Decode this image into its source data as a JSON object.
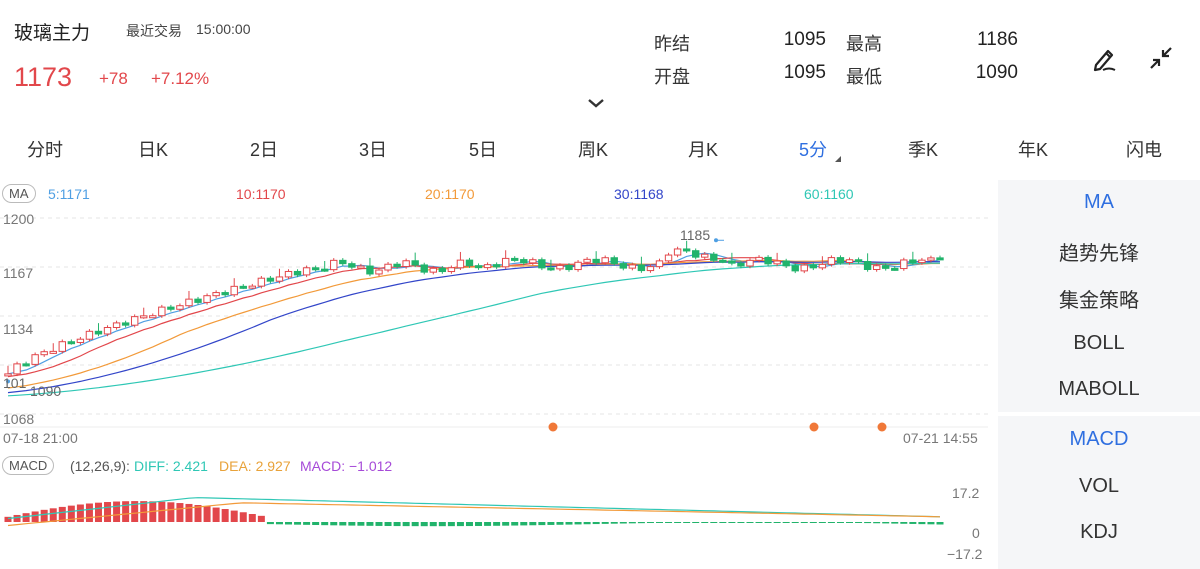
{
  "header": {
    "title": "玻璃主力",
    "trade_label": "最近交易",
    "trade_time": "15:00:00",
    "price": "1173",
    "change": "+78",
    "change_pct": "+7.12%",
    "stats": {
      "prev_close_label": "昨结",
      "prev_close": "1095",
      "high_label": "最高",
      "high": "1186",
      "open_label": "开盘",
      "open": "1095",
      "low_label": "最低",
      "low": "1090"
    },
    "icons": [
      "pen-icon",
      "collapse-icon"
    ]
  },
  "tabs": [
    "分时",
    "日K",
    "2日",
    "3日",
    "5日",
    "周K",
    "月K",
    "5分",
    "季K",
    "年K",
    "闪电"
  ],
  "active_tab": "5分",
  "ma": {
    "tag": "MA",
    "items": [
      {
        "label": "5:1171",
        "color": "#4f9fe3"
      },
      {
        "label": "10:1170",
        "color": "#e2474b"
      },
      {
        "label": "20:1170",
        "color": "#f29a3a"
      },
      {
        "label": "30:1168",
        "color": "#3346c9"
      },
      {
        "label": "60:1160",
        "color": "#2fc7b5"
      }
    ]
  },
  "price_axis": {
    "labels": [
      "1200",
      "1167",
      "1134",
      "1068"
    ],
    "marker_high": "1185",
    "marker_low_a": "101",
    "marker_low_b": "1090"
  },
  "time_axis": {
    "start": "07-18 21:00",
    "end": "07-21 14:55"
  },
  "macd": {
    "tag": "MACD",
    "params": "(12,26,9):",
    "diff": "DIFF: 2.421",
    "dea": "DEA: 2.927",
    "macd": "MACD: −1.012",
    "axis_top": "17.2",
    "axis_mid": "0",
    "axis_bottom": "−17.2",
    "colors": {
      "diff": "#2fc7b5",
      "dea": "#f29a3a",
      "macd": "#a64ad8",
      "up": "#e2474b",
      "down": "#21b36b"
    }
  },
  "side_panel": {
    "upper": [
      "MA",
      "趋势先锋",
      "集金策略",
      "BOLL",
      "MABOLL"
    ],
    "upper_active": "MA",
    "lower": [
      "MACD",
      "VOL",
      "KDJ"
    ],
    "lower_active": "MACD"
  },
  "colors": {
    "up": "#e2474b",
    "down": "#21b36b",
    "accent": "#2f6fe0"
  }
}
